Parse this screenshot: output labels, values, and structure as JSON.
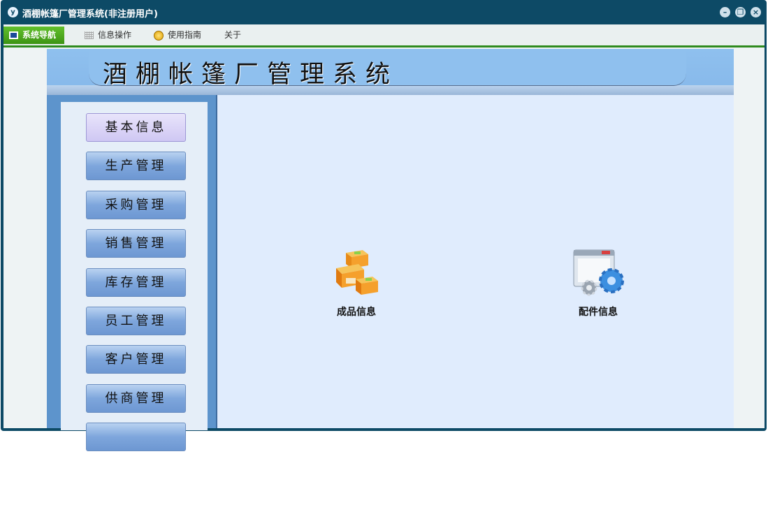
{
  "window": {
    "title": "酒棚帐篷厂管理系统(非注册用户)",
    "app_icon": "y"
  },
  "menubar": {
    "items": [
      {
        "label": "系统导航",
        "icon": "screen-icon",
        "active": true
      },
      {
        "label": "信息操作",
        "icon": "grid-icon"
      },
      {
        "label": "使用指南",
        "icon": "guide-icon"
      },
      {
        "label": "关于"
      }
    ]
  },
  "banner": {
    "title": "酒棚帐篷厂管理系统"
  },
  "sidebar": {
    "items": [
      {
        "label": "基本信息"
      },
      {
        "label": "生产管理"
      },
      {
        "label": "采购管理"
      },
      {
        "label": "销售管理"
      },
      {
        "label": "库存管理"
      },
      {
        "label": "员工管理"
      },
      {
        "label": "客户管理"
      },
      {
        "label": "供商管理"
      }
    ]
  },
  "main": {
    "tiles": [
      {
        "label": "成品信息",
        "icon": "boxes-icon"
      },
      {
        "label": "配件信息",
        "icon": "gear-window-icon"
      }
    ]
  },
  "colors": {
    "titlebar": "#0d4a66",
    "menu_accent": "#2e8b1e",
    "banner": "#8fc0ee",
    "sidebar": "#5d94cc",
    "main_bg": "#e0ecfd"
  }
}
